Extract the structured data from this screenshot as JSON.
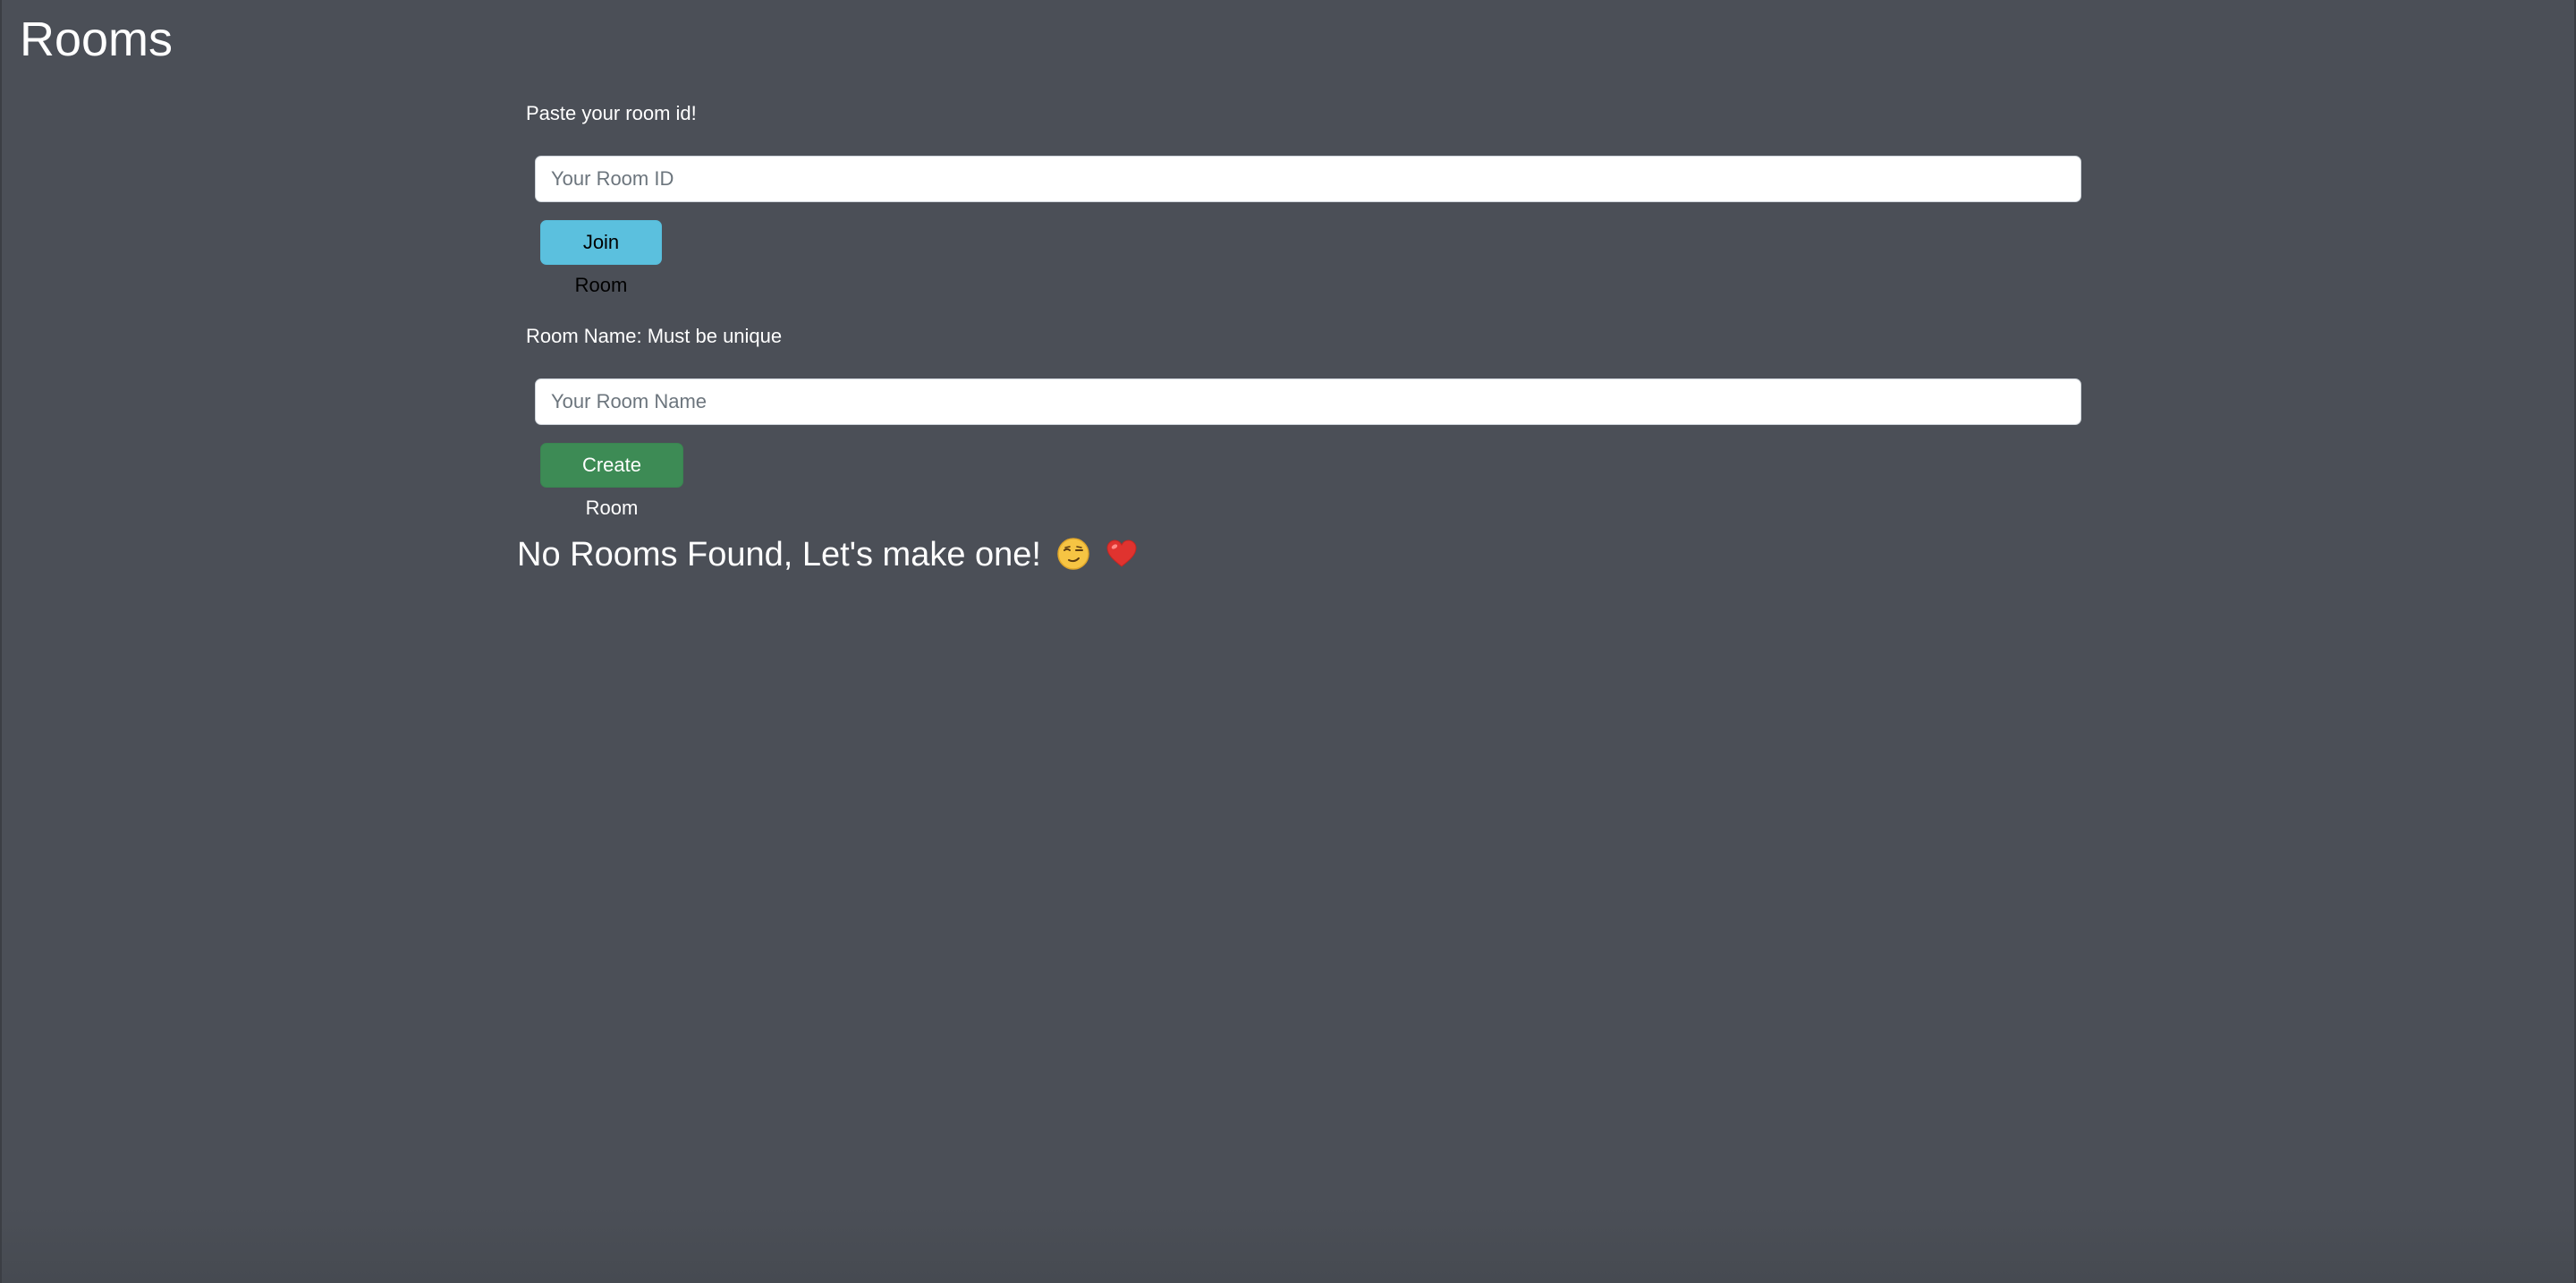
{
  "page": {
    "title": "Rooms"
  },
  "join": {
    "label": "Paste your room id!",
    "input_placeholder": "Your Room ID",
    "input_value": "",
    "button_label": "Join Room"
  },
  "create": {
    "label": "Room Name: Must be unique",
    "input_placeholder": "Your Room Name",
    "input_value": "",
    "button_label": "Create Room"
  },
  "rooms": {
    "empty_message": "No Rooms Found, Let's make one!",
    "emojis": [
      "wink-emoji",
      "heart-emoji"
    ]
  },
  "colors": {
    "background": "#4b4f57",
    "join_button": "#5bc0de",
    "create_button": "#3d8b55",
    "heart": "#e0332f",
    "wink_face": "#f6c443"
  }
}
